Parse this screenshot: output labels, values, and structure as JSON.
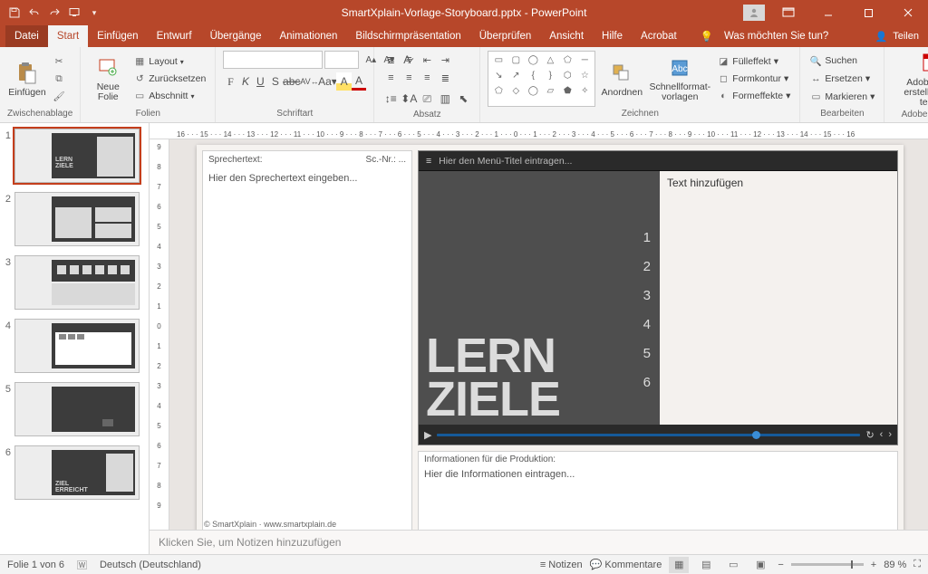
{
  "title": "SmartXplain-Vorlage-Storyboard.pptx  -  PowerPoint",
  "menu": {
    "file": "Datei",
    "start": "Start",
    "insert": "Einfügen",
    "design": "Entwurf",
    "trans": "Übergänge",
    "anim": "Animationen",
    "show": "Bildschirmpräsentation",
    "review": "Überprüfen",
    "view": "Ansicht",
    "help": "Hilfe",
    "acrobat": "Acrobat",
    "tell": "Was möchten Sie tun?",
    "share": "Teilen"
  },
  "ribbon": {
    "clipboard": {
      "label": "Zwischenablage",
      "paste": "Einfügen"
    },
    "slides": {
      "label": "Folien",
      "new": "Neue\nFolie",
      "layout": "Layout",
      "reset": "Zurücksetzen",
      "section": "Abschnitt"
    },
    "font": {
      "label": "Schriftart"
    },
    "paragraph": {
      "label": "Absatz"
    },
    "drawing": {
      "label": "Zeichnen",
      "arrange": "Anordnen",
      "quick": "Schnellformat-\nvorlagen",
      "fill": "Fülleffekt",
      "outline": "Formkontur",
      "effects": "Formeffekte"
    },
    "editing": {
      "label": "Bearbeiten",
      "find": "Suchen",
      "replace": "Ersetzen",
      "select": "Markieren"
    },
    "adobe": {
      "label": "Adobe Acrobat",
      "create": "Adobe PDF\nerstellen und teilen"
    }
  },
  "ruler": "16 · · · 15 · · · 14 · · · 13 · · · 12 · · · 11 · · · 10 · · · 9 · · · 8 · · · 7 · · · 6 · · · 5 · · · 4 · · · 3 · · · 2 · · · 1 · · · 0 · · · 1 · · · 2 · · · 3 · · · 4 · · · 5 · · · 6 · · · 7 · · · 8 · · · 9 · · · 10 · · · 11 · · · 12 · · · 13 · · · 14 · · · 15 · · · 16",
  "rulerV": [
    "9",
    "8",
    "7",
    "6",
    "5",
    "4",
    "3",
    "2",
    "1",
    "0",
    "1",
    "2",
    "3",
    "4",
    "5",
    "6",
    "7",
    "8",
    "9"
  ],
  "thumbs": [
    "1",
    "2",
    "3",
    "4",
    "5",
    "6"
  ],
  "slide": {
    "sprecher_label": "Sprechertext:",
    "sc_label": "Sc.-Nr.: ...",
    "sprecher_hint": "Hier den Sprechertext eingeben...",
    "menu_hint": "Hier den Menü-Titel eintragen...",
    "big": "LERN\nZIELE",
    "nums": [
      "1",
      "2",
      "3",
      "4",
      "5",
      "6"
    ],
    "side_hint": "Text hinzufügen",
    "prod_label": "Informationen für die Produktion:",
    "prod_hint": "Hier die Informationen eintragen...",
    "copyright": "© SmartXplain · www.smartxplain.de",
    "thumb1_text": "LERN\nZIELE",
    "thumb6_text": "ZIEL\nERREICHT"
  },
  "notes": "Klicken Sie, um Notizen hinzuzufügen",
  "status": {
    "slide": "Folie 1 von 6",
    "lang": "Deutsch (Deutschland)",
    "notes": "Notizen",
    "comments": "Kommentare",
    "zoom": "89 %"
  }
}
